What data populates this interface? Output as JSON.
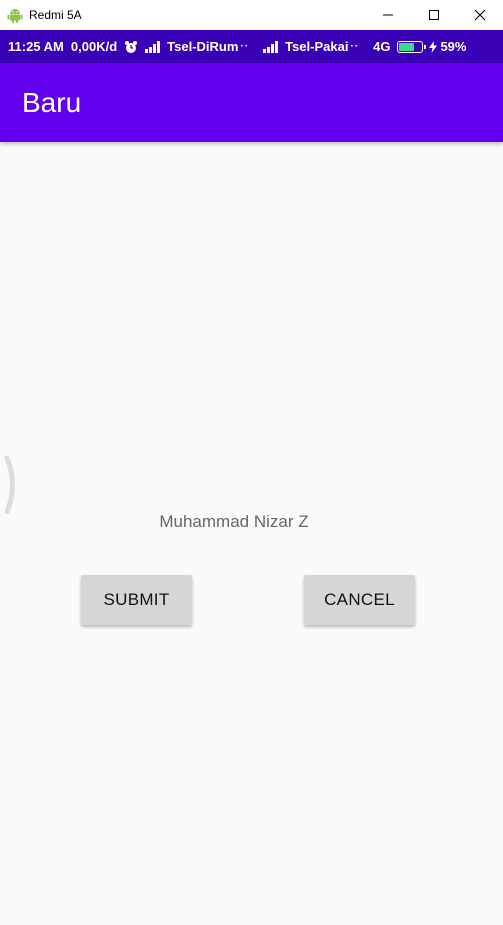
{
  "window": {
    "title": "Redmi 5A",
    "app_icon": "android-icon",
    "controls": [
      "minimize-icon",
      "maximize-icon",
      "close-icon"
    ]
  },
  "status_bar": {
    "time": "11:25 AM",
    "net_speed": "0,00K/d",
    "alarm_icon": "alarm-icon",
    "sim1": "Tsel-DiRum",
    "sim2": "Tsel-Pakai",
    "dots": "··",
    "network_type": "4G",
    "battery_percent": "59%",
    "battery_level": 0.59,
    "battery_color": "#3ddc84",
    "background": "#3a00b5"
  },
  "app_bar": {
    "title": "Baru",
    "color": "#6200ee"
  },
  "content": {
    "name_text": "Muhammad Nizar Z",
    "submit_label": "SUBMIT",
    "cancel_label": "CANCEL"
  }
}
